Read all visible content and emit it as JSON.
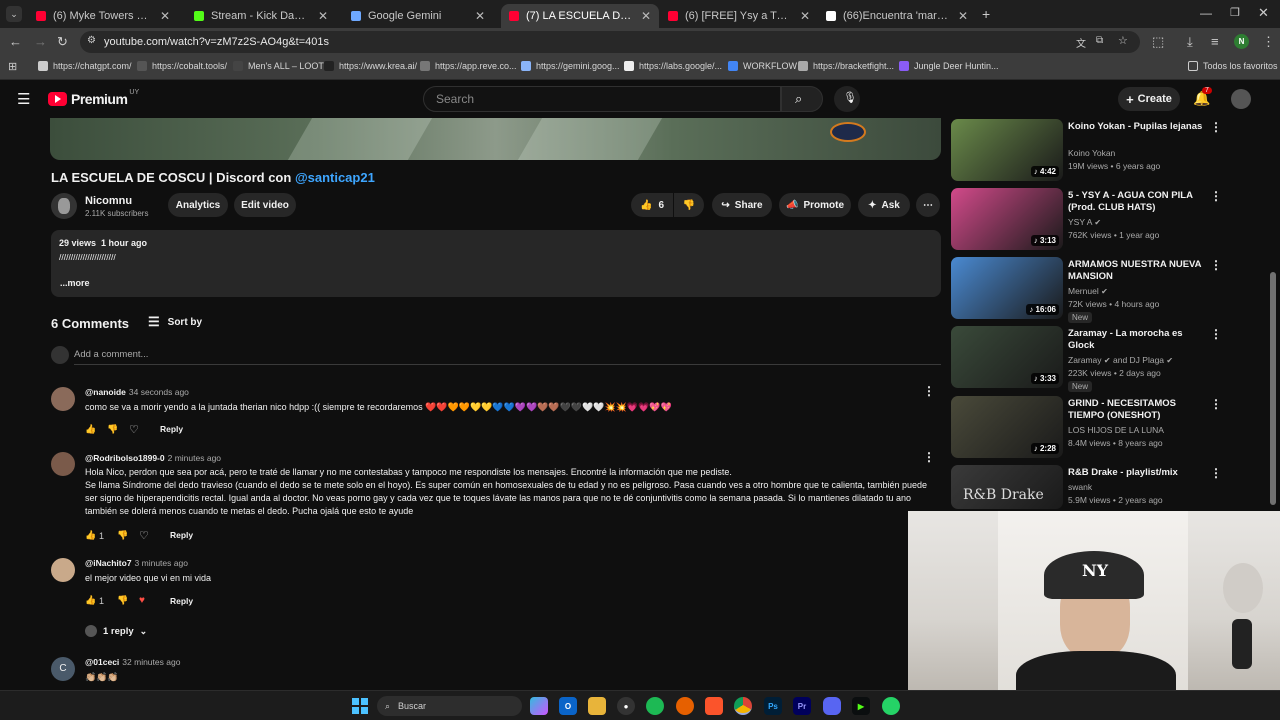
{
  "tabs": [
    {
      "title": "(6) Myke Towers - TOP TIER (Vi",
      "color": "#ff0033"
    },
    {
      "title": "Stream - Kick Dashboard",
      "color": "#53fc18"
    },
    {
      "title": "Google Gemini",
      "color": "#6ea8fe"
    },
    {
      "title": "(7) LA ESCUELA DE COSCU | Dis",
      "color": "#ff0033"
    },
    {
      "title": "(6) [FREE] Ysy a Trap Beat Instru",
      "color": "#ff0033"
    },
    {
      "title": "(66)Encuentra 'martin cirio' en T",
      "color": "#ffffff"
    }
  ],
  "address": {
    "url": "youtube.com/watch?v=zM7z2S-AO4g&t=401s"
  },
  "profile_letter": "N",
  "bookmarks": [
    "https://chatgpt.com/",
    "https://cobalt.tools/",
    "Men's ALL – LOOT",
    "https://www.krea.ai/",
    "https://app.reve.co...",
    "https://gemini.goog...",
    "https://labs.google/...",
    "WORKFLOW",
    "https://bracketfight...",
    "Jungle Deer Huntin..."
  ],
  "bookmarks_all": "Todos los favoritos",
  "header": {
    "logo": "Premium",
    "region": "UY",
    "search_placeholder": "Search",
    "create_label": "Create",
    "notif_count": "7"
  },
  "video": {
    "title": "LA ESCUELA DE COSCU | Discord con",
    "mention": "@santicap21",
    "channel": "Nicomnu",
    "subscribers": "2.11K subscribers",
    "analytics": "Analytics",
    "edit": "Edit video",
    "likes": "6",
    "share": "Share",
    "promote": "Promote",
    "ask": "Ask",
    "desc_meta": "29 views  1 hour ago",
    "desc_text": "////////////////////////",
    "more": "...more"
  },
  "comments_header": {
    "count": "6 Comments",
    "sort": "Sort by",
    "add": "Add a comment..."
  },
  "comments": [
    {
      "author": "@nanoide",
      "ago": "34 seconds ago",
      "text": "como se va a morir yendo a la juntada therian nico hdpp :(( siempre te recordaremos ❤️❤️🧡🧡💛💛💙💙💜💜🤎🤎🖤🖤🤍🤍💥💥💗💗💖💖",
      "likes": "",
      "reply": "Reply",
      "avatar_color": "#8a6a5a"
    },
    {
      "author": "@Rodribolso1899-0",
      "ago": "2 minutes ago",
      "text": "Hola Nico, perdon que sea por acá, pero te traté de llamar y no me contestabas y tampoco me respondiste los mensajes. Encontré la información que me pediste.\nSe llama Síndrome del dedo travieso (cuando el dedo se te mete solo en el hoyo). Es super común en homosexuales de tu edad y no es peligroso. Pasa cuando ves a otro hombre que te calienta, también puede ser signo de hiperapendicitis rectal. Igual anda al doctor. No veas porno gay y cada vez que te toques lávate las manos para que no te dé conjuntivitis como la semana pasada. Si lo mantienes dilatado tu ano también se dolerá menos cuando te metas el dedo. Pucha ojalá que esto te ayude",
      "likes": "1",
      "reply": "Reply",
      "avatar_color": "#7a5a4a"
    },
    {
      "author": "@iNachito7",
      "ago": "3 minutes ago",
      "text": "el mejor video que vi en mi vida",
      "likes": "1",
      "reply": "Reply",
      "avatar_color": "#c9a98a",
      "replies_label": "1 reply"
    },
    {
      "author": "@01ceci",
      "ago": "32 minutes ago",
      "text": "👏🏼👏🏼👏🏼",
      "avatar_letter": "C",
      "avatar_color": "#4a5a6a"
    }
  ],
  "sidebar": [
    {
      "title": "Koino Yokan - Pupilas lejanas",
      "channel": "Koino Yokan",
      "meta": "19M views • 6 years ago",
      "duration": "4:42",
      "verified": false,
      "new": false,
      "color": "#6a8a4a"
    },
    {
      "title": "5 - YSY A  - AGUA CON PILA (Prod. CLUB HATS)",
      "channel": "YSY A",
      "meta": "762K views • 1 year ago",
      "duration": "3:13",
      "verified": true,
      "new": false,
      "color": "#d24a8a"
    },
    {
      "title": "ARMAMOS NUESTRA NUEVA MANSION",
      "channel": "Mernuel",
      "meta": "72K views • 4 hours ago",
      "duration": "16:06",
      "verified": true,
      "new": true,
      "new_label": "New",
      "color": "#4a8ad2"
    },
    {
      "title": "Zaramay - La morocha es Glock",
      "channel": "Zaramay",
      "channel2": "and DJ Plaga",
      "meta": "223K views • 2 days ago",
      "duration": "3:33",
      "verified": true,
      "new": true,
      "new_label": "New",
      "color": "#3a4a3a"
    },
    {
      "title": "GRIND - NECESITAMOS TIEMPO (ONESHOT)",
      "channel": "LOS HIJOS DE LA LUNA",
      "meta": "8.4M views • 8 years ago",
      "duration": "2:28",
      "verified": false,
      "new": false,
      "color": "#4a4a3a"
    },
    {
      "title": "R&B Drake - playlist/mix",
      "channel": "swank",
      "meta": "5.9M views • 2 years ago",
      "duration": "",
      "verified": false,
      "new": false,
      "color": "#3a3a3a",
      "thumb_text": "R&B Drake"
    }
  ],
  "taskbar": {
    "search": "Buscar"
  }
}
